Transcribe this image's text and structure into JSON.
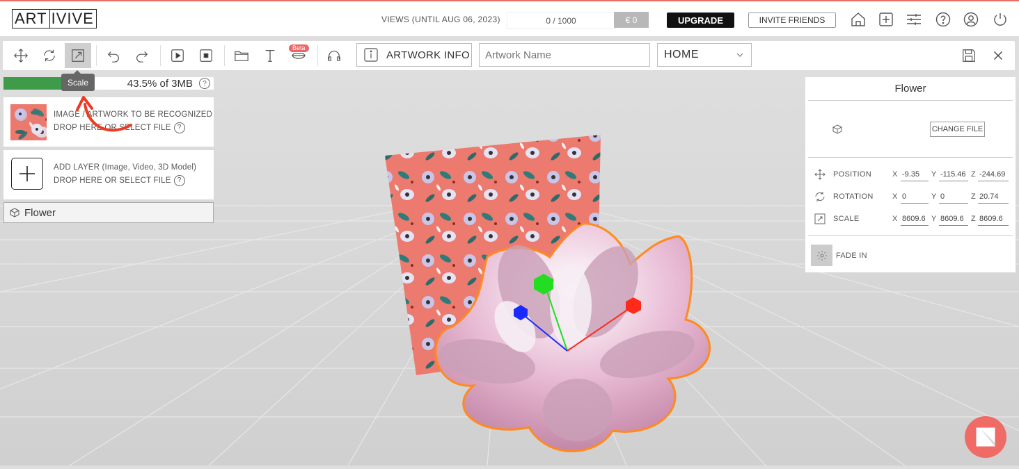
{
  "header": {
    "logo_part1": "ART",
    "logo_part2": "IVIVE",
    "views_label": "VIEWS (UNTIL AUG 06, 2023)",
    "views_count": "0 / 1000",
    "views_cost": "€ 0",
    "upgrade_label": "UPGRADE",
    "invite_label": "INVITE FRIENDS",
    "icons": [
      "home-icon",
      "add-icon",
      "sliders-icon",
      "help-icon",
      "user-icon",
      "power-icon"
    ]
  },
  "toolbar": {
    "tools": [
      "move-icon",
      "rotate-icon",
      "scale-icon",
      "undo-icon",
      "redo-icon",
      "play-icon",
      "stop-icon",
      "folder-icon",
      "text-icon",
      "lips-icon",
      "headphones-icon"
    ],
    "active_tool": "scale-icon",
    "beta_badge": "Beta",
    "artwork_info_label": "ARTWORK INFO",
    "artwork_name_placeholder": "Artwork Name",
    "scene_select_value": "HOME",
    "actions": [
      "save-icon",
      "close-icon"
    ]
  },
  "tooltip": {
    "text": "Scale"
  },
  "storage": {
    "used_fraction": 0.435,
    "label": "43.5% of 3MB",
    "help": "?"
  },
  "left_panel": {
    "artwork_card": {
      "line1": "IMAGE / ARTWORK TO BE RECOGNIZED",
      "line2": "DROP HERE OR SELECT FILE",
      "help": "?"
    },
    "add_layer_card": {
      "line1": "ADD LAYER (Image, Video, 3D Model)",
      "line2": "DROP HERE OR SELECT FILE",
      "help": "?"
    },
    "layers": [
      {
        "name": "Flower"
      }
    ]
  },
  "right_panel": {
    "title": "Flower",
    "change_file_label": "CHANGE FILE",
    "position": {
      "label": "POSITION",
      "x": "-9.35",
      "y": "-115.46",
      "z": "-244.69"
    },
    "rotation": {
      "label": "ROTATION",
      "x": "0",
      "y": "0",
      "z": "20.74"
    },
    "scale": {
      "label": "SCALE",
      "x": "8609.6",
      "y": "8609.6",
      "z": "8609.6"
    },
    "axis_x": "X",
    "axis_y": "Y",
    "axis_z": "Z",
    "fade_in_label": "FADE IN"
  },
  "colors": {
    "accent": "#f06a66",
    "progress": "#3e9b4a",
    "gizmo_x": "#ff2a1a",
    "gizmo_y": "#22dd22",
    "gizmo_z": "#1a2aff",
    "selection_outline": "#ff8a1e"
  }
}
